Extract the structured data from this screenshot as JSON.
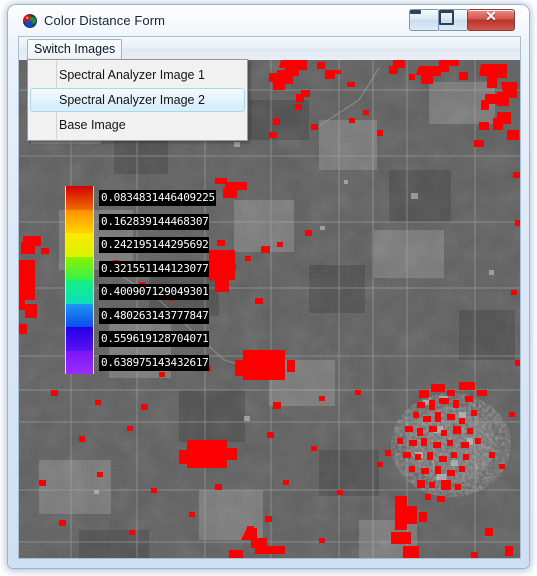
{
  "window": {
    "title": "Color Distance Form",
    "icon": "app-sphere-icon",
    "buttons": {
      "minimize": "minimize-icon",
      "maximize": "maximize-icon",
      "close": "✕"
    }
  },
  "menubar": {
    "switch_images_label": "Switch Images"
  },
  "dropdown": {
    "items": [
      {
        "label": "Spectral Analyzer Image 1",
        "selected": false
      },
      {
        "label": "Spectral Analyzer Image 2",
        "selected": true
      },
      {
        "label": "Base Image",
        "selected": false
      }
    ]
  },
  "legend": {
    "entries": [
      {
        "value": "0.0834831446409225",
        "color_top": "#d40000",
        "color_bottom": "#f06c00"
      },
      {
        "value": "0.162839144468307",
        "color_top": "#ff9000",
        "color_bottom": "#ffd400"
      },
      {
        "value": "0.242195144295692",
        "color_top": "#ffe800",
        "color_bottom": "#d8f200"
      },
      {
        "value": "0.321551144123077",
        "color_top": "#8cf000",
        "color_bottom": "#34f24a"
      },
      {
        "value": "0.400907129049301",
        "color_top": "#14f07e",
        "color_bottom": "#10dcc0"
      },
      {
        "value": "0.480263143777847",
        "color_top": "#1e96f0",
        "color_bottom": "#0c4cf0"
      },
      {
        "value": "0.559619128704071",
        "color_top": "#2000e8",
        "color_bottom": "#5a12f0"
      },
      {
        "value": "0.638975143432617",
        "color_top": "#7a16f4",
        "color_bottom": "#9a2cff"
      }
    ]
  },
  "image": {
    "name": "spectral-analyzer-image-2",
    "description": "Grayscale satellite raster with red classified overlay regions",
    "base_color": "#575757",
    "overlay_color": "#ff0000"
  },
  "colors": {
    "titlebar_text": "#10243a",
    "close_button": "#c0392b",
    "menu_highlight": "#d7edfa",
    "legend_label_bg": "#000000",
    "legend_label_fg": "#ffffff"
  }
}
